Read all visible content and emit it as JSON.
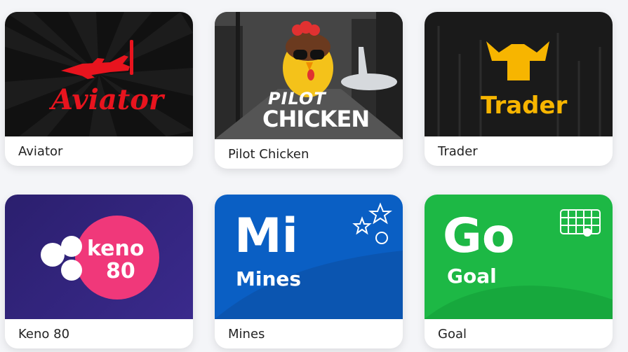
{
  "games": [
    {
      "id": "aviator",
      "label": "Aviator",
      "logo_text": "Aviator",
      "brand_color": "#e8141e",
      "icon": "plane-icon"
    },
    {
      "id": "pilot-chicken",
      "label": "Pilot Chicken",
      "logo_line1": "PILOT",
      "logo_line2": "CHICKEN",
      "icon": "chicken-icon"
    },
    {
      "id": "trader",
      "label": "Trader",
      "logo_text": "Trader",
      "brand_color": "#f7b500",
      "icon": "trader-icon"
    },
    {
      "id": "keno80",
      "label": "Keno 80",
      "logo_line1": "keno",
      "logo_line2": "80",
      "brand_color": "#f0387a",
      "icon": "keno-balls-icon"
    },
    {
      "id": "mines",
      "label": "Mines",
      "big_text": "Mi",
      "sub_text": "Mines",
      "brand_color": "#0a5fc4",
      "icon": "stars-icon"
    },
    {
      "id": "goal",
      "label": "Goal",
      "big_text": "Go",
      "sub_text": "Goal",
      "brand_color": "#1db845",
      "icon": "goal-net-icon"
    }
  ]
}
